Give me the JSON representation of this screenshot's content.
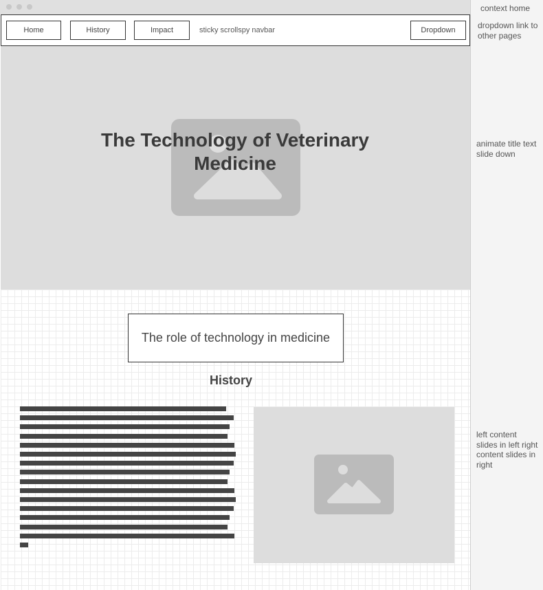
{
  "nav": {
    "items": [
      "Home",
      "History",
      "Impact"
    ],
    "note": "sticky scrollspy navbar",
    "dropdown_label": "Dropdown"
  },
  "hero": {
    "title": "The Technology of Veterinary Medicine",
    "image_icon": "image-placeholder-icon"
  },
  "section": {
    "role_title": "The role of technology in medicine",
    "history_heading": "History",
    "paragraph_lines": 16,
    "image_icon": "image-placeholder-icon"
  },
  "notes": {
    "context": "context home",
    "dropdown": "dropdown link to other pages",
    "animate": "animate title text slide down",
    "slides": "left content slides in left right content slides in right"
  },
  "colors": {
    "hero_bg": "#dddddd",
    "placeholder": "#bbbbbb",
    "text_bar": "#444444",
    "notes_bg": "#f4f4f4"
  }
}
